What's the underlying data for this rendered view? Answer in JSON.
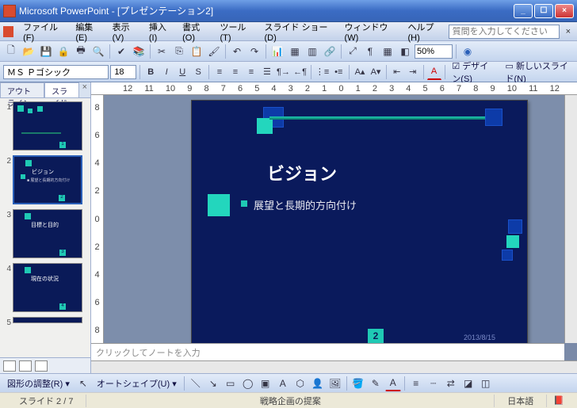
{
  "app": {
    "title": "Microsoft PowerPoint - [プレゼンテーション2]"
  },
  "menu": {
    "file": "ファイル(F)",
    "edit": "編集(E)",
    "view": "表示(V)",
    "insert": "挿入(I)",
    "format": "書式(O)",
    "tools": "ツール(T)",
    "slideshow": "スライド ショー(D)",
    "window": "ウィンドウ(W)",
    "help": "ヘルプ(H)",
    "help_placeholder": "質問を入力してください"
  },
  "toolbar": {
    "zoom": "50%"
  },
  "format": {
    "font": "ＭＳ Ｐゴシック",
    "size": "18",
    "bold": "B",
    "italic": "I",
    "underline": "U",
    "shadow": "S",
    "design": "デザイン(S)",
    "newslide": "新しいスライド(N)"
  },
  "ruler": {
    "h": [
      "12",
      "11",
      "10",
      "9",
      "8",
      "7",
      "6",
      "5",
      "4",
      "3",
      "2",
      "1",
      "0",
      "1",
      "2",
      "3",
      "4",
      "5",
      "6",
      "7",
      "8",
      "9",
      "10",
      "11",
      "12"
    ],
    "v": [
      "8",
      "6",
      "4",
      "2",
      "0",
      "2",
      "4",
      "6",
      "8"
    ]
  },
  "pane": {
    "outline": "アウトライン",
    "slides": "スライド",
    "thumbs": [
      {
        "num": "1",
        "title": "",
        "sub": ""
      },
      {
        "num": "2",
        "title": "ビジョン",
        "sub": "■ 展望と長期的方向付け"
      },
      {
        "num": "3",
        "title": "目標と目的",
        "sub": ""
      },
      {
        "num": "4",
        "title": "現在の状況",
        "sub": ""
      },
      {
        "num": "5",
        "title": "",
        "sub": ""
      }
    ]
  },
  "slide": {
    "title": "ビジョン",
    "body": "展望と長期的方向付け",
    "page": "2",
    "date": "2013/8/15"
  },
  "notes": {
    "placeholder": "クリックしてノートを入力"
  },
  "bottombar": {
    "adjust": "図形の調整(R)",
    "autoshape": "オートシェイプ(U)"
  },
  "status": {
    "slide": "スライド 2 / 7",
    "template": "戦略企画の提案",
    "lang": "日本語"
  }
}
